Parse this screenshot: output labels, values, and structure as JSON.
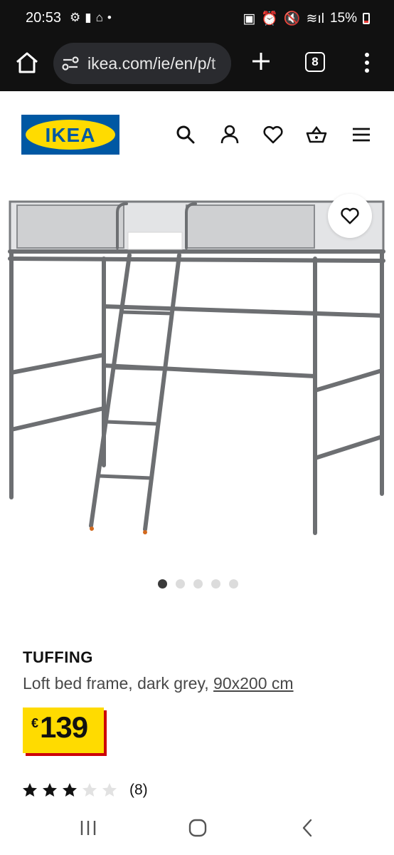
{
  "status_bar": {
    "time": "20:53",
    "battery": "15%"
  },
  "browser": {
    "url": "ikea.com/ie/en/p/t",
    "tab_count": "8"
  },
  "header": {
    "logo_text": "IKEA",
    "icons": [
      "search-icon",
      "account-icon",
      "heart-icon",
      "basket-icon",
      "hamburger-menu-icon"
    ]
  },
  "product": {
    "name": "TUFFING",
    "description": "Loft bed frame, dark grey, ",
    "size": "90x200 cm",
    "currency": "€",
    "price": "139",
    "rating_count": "(8)",
    "rating_stars": 3,
    "rating_max": 5,
    "image_count": 5,
    "active_image": 1
  },
  "colors": {
    "ikea_blue": "#0058a3",
    "ikea_yellow": "#ffdb00",
    "price_shadow": "#cc0008"
  }
}
